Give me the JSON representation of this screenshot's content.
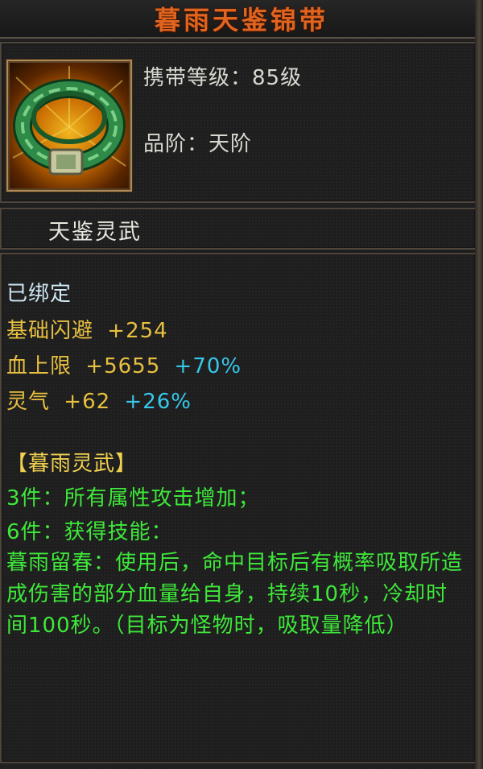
{
  "item": {
    "name": "暮雨天鉴锦带",
    "icon": "jade-belt-icon",
    "level_label": "携带等级：",
    "level_value": "85级",
    "grade_label": "品阶：",
    "grade_value": "天阶"
  },
  "set_title": "天鉴灵武",
  "bound": "已绑定",
  "stats": [
    {
      "name": "基础闪避",
      "value": "+254",
      "percent": ""
    },
    {
      "name": "血上限",
      "value": "+5655",
      "percent": "+70%"
    },
    {
      "name": "灵气",
      "value": "+62",
      "percent": "+26%"
    }
  ],
  "set": {
    "name": "【暮雨灵武】",
    "bonus_3": "3件：所有属性攻击增加；",
    "bonus_6": "6件：获得技能：",
    "skill_desc": "暮雨留春：使用后，命中目标后有概率吸取所造成伤害的部分血量给自身，持续10秒，冷却时间100秒。（目标为怪物时，吸取量降低）"
  },
  "colors": {
    "title": "#e06420",
    "stat_name": "#e8c040",
    "percent": "#36c8ea",
    "set_text": "#3ee83a",
    "bound": "#cfe8f4"
  }
}
